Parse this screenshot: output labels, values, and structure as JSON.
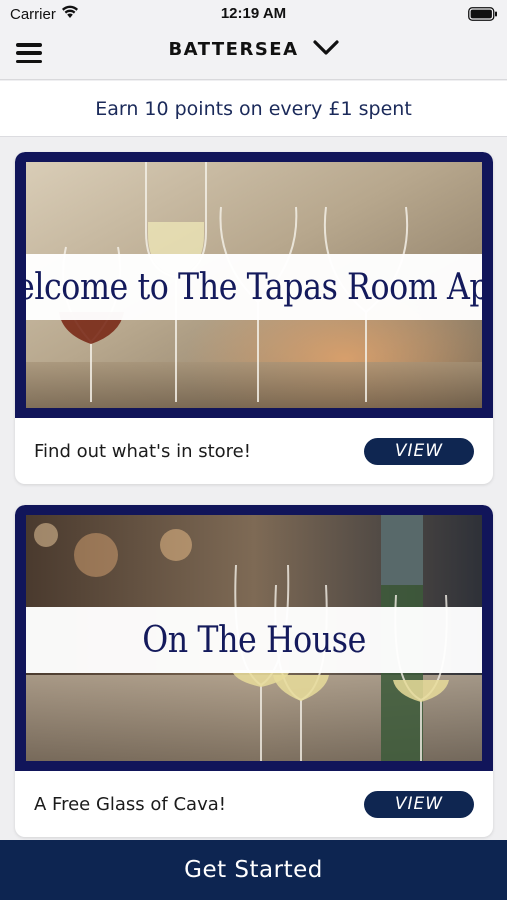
{
  "status_bar": {
    "carrier": "Carrier",
    "time": "12:19 AM"
  },
  "nav": {
    "location": "BATTERSEA"
  },
  "points_banner": {
    "text": "Earn 10 points on every £1 spent"
  },
  "cards": [
    {
      "image_title": "Welcome to The Tapas Room App!",
      "description": "Find out what's in store!",
      "button_label": "VIEW"
    },
    {
      "image_title": "On The House",
      "description": "A  Free Glass of Cava!",
      "button_label": "VIEW"
    }
  ],
  "bottom_bar": {
    "label": "Get Started"
  },
  "colors": {
    "brand_navy": "#0d2551",
    "frame_navy": "#11155a",
    "title_navy": "#141a5c"
  },
  "icons": [
    "wifi-icon",
    "battery-icon",
    "menu-icon",
    "chevron-down-icon"
  ]
}
